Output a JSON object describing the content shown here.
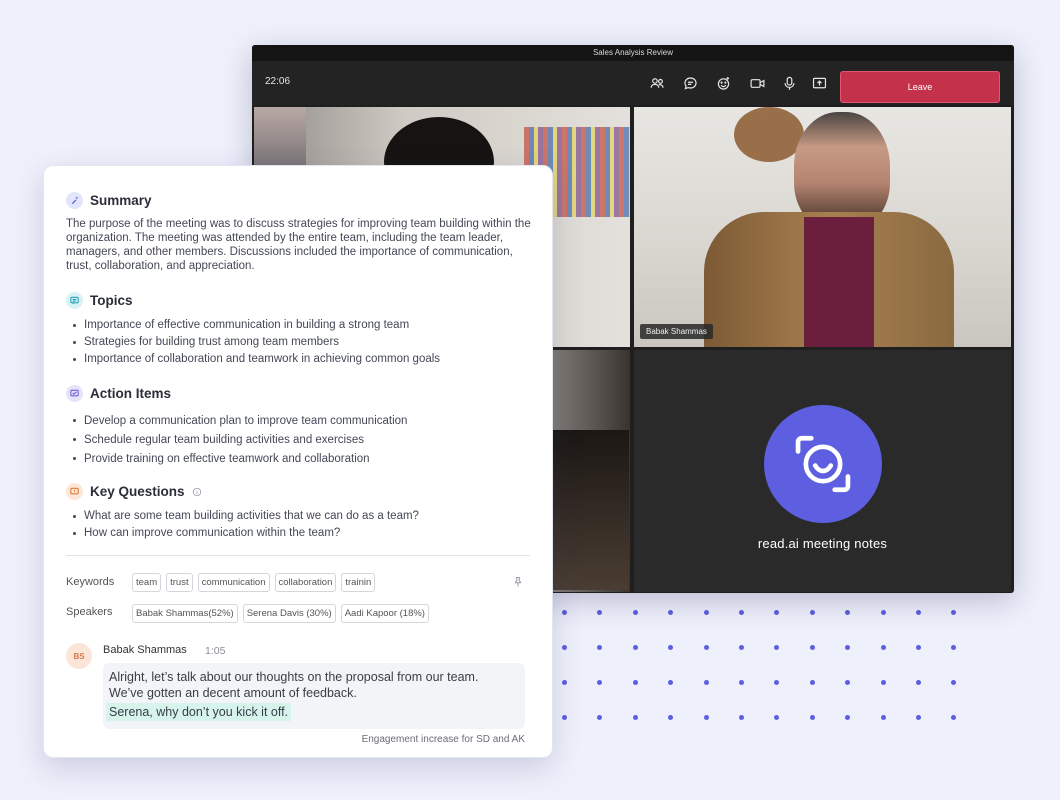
{
  "window": {
    "title": "Sales Analysis Review",
    "clock": "22:06",
    "leave_label": "Leave",
    "toolbar_icons": [
      "people-icon",
      "chat-icon",
      "reactions-icon",
      "camera-icon",
      "mic-icon",
      "share-screen-icon"
    ]
  },
  "video": {
    "participant_name": "Babak Shammas",
    "bot_label": "read.ai meeting notes"
  },
  "summary": {
    "title": "Summary",
    "text": "The purpose of the meeting was to discuss strategies for improving team building within the organization. The meeting was attended by the entire team, including the team leader, managers, and other members. Discussions  included the importance of communication, trust, collaboration, and appreciation."
  },
  "topics": {
    "title": "Topics",
    "items": [
      "Importance of effective communication in building a strong team",
      "Strategies for building trust among team members",
      "Importance of collaboration and teamwork in achieving common goals"
    ]
  },
  "action_items": {
    "title": "Action Items",
    "items": [
      "Develop a communication plan to improve team communication",
      "Schedule regular team building activities and exercises",
      "Provide training on effective teamwork and collaboration"
    ]
  },
  "key_questions": {
    "title": "Key Questions",
    "items": [
      "What are some team building activities that we can do as a team?",
      "How can improve communication within the team?"
    ]
  },
  "keywords": {
    "label": "Keywords",
    "items": [
      "team",
      "trust",
      "communication",
      "collaboration",
      "trainin"
    ]
  },
  "speakers": {
    "label": "Speakers",
    "items": [
      "Babak Shammas(52%)",
      "Serena Davis (30%)",
      "Aadi Kapoor (18%)"
    ]
  },
  "transcript": {
    "initials": "BS",
    "name": "Babak Shammas",
    "time": "1:05",
    "line1": "Alright, let’s talk about our thoughts on the proposal from our team.",
    "line2": "We’ve gotten an decent amount of feedback.",
    "highlight": "Serena, why don’t you kick it off.",
    "footnote": "Engagement increase for SD and AK"
  },
  "colors": {
    "accent": "#5d5fe0",
    "leave": "#c4314b",
    "highlight": "#d6f3ec"
  }
}
